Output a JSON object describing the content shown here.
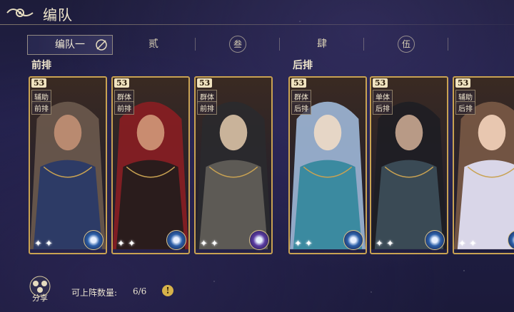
{
  "header": {
    "title": "编队"
  },
  "tabs": [
    {
      "label": "编队一",
      "active": true
    },
    {
      "label": "贰"
    },
    {
      "label": "叁"
    },
    {
      "label": "肆"
    },
    {
      "label": "伍"
    }
  ],
  "rows": {
    "front": "前排",
    "back": "后排"
  },
  "cards": [
    {
      "level": "53",
      "type": "辅助",
      "position": "前排",
      "element": "water",
      "palette": [
        "#6b5a4e",
        "#2d3b66",
        "#b98a70"
      ]
    },
    {
      "level": "53",
      "type": "群体",
      "position": "前排",
      "element": "water",
      "palette": [
        "#8a1e22",
        "#2a1c1c",
        "#c98c70"
      ]
    },
    {
      "level": "53",
      "type": "群体",
      "position": "前排",
      "element": "void",
      "palette": [
        "#2a2a2e",
        "#5d5a55",
        "#c9b39a"
      ]
    },
    {
      "level": "53",
      "type": "群体",
      "position": "后排",
      "element": "water",
      "palette": [
        "#9fb8d8",
        "#3b8aa0",
        "#e6d6c6"
      ]
    },
    {
      "level": "53",
      "type": "单体",
      "position": "后排",
      "element": "water",
      "palette": [
        "#1e1e24",
        "#3a4a55",
        "#b89a86"
      ]
    },
    {
      "level": "53",
      "type": "辅助",
      "position": "后排",
      "element": "water",
      "palette": [
        "#7a5a46",
        "#d9d6e8",
        "#e8c7b0"
      ]
    }
  ],
  "footer": {
    "share_label": "分享",
    "count_label": "可上阵数量:",
    "count_value": "6/6",
    "info_glyph": "!"
  },
  "colors": {
    "frame_gold": "#c9a252",
    "water_element": "#2b5fa8",
    "void_element": "#5a3aa0"
  }
}
